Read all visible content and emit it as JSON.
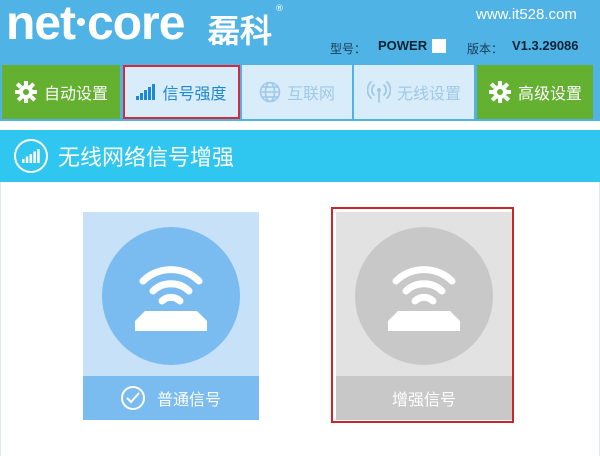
{
  "header": {
    "logo_text_left": "net",
    "logo_text_right": "core",
    "logo_cn": "磊科",
    "registered": "®",
    "watermark": "www.it528.com",
    "model_label": "型号：",
    "model_value": "POWER",
    "version_label": "版本：",
    "version_value": "V1.3.29086"
  },
  "nav": {
    "tabs": [
      {
        "label": "自动设置",
        "icon": "gear-icon"
      },
      {
        "label": "信号强度",
        "icon": "signal-bars-icon"
      },
      {
        "label": "互联网",
        "icon": "globe-icon"
      },
      {
        "label": "无线设置",
        "icon": "wireless-antenna-icon"
      },
      {
        "label": "高级设置",
        "icon": "gear-icon"
      }
    ],
    "active_tab": "信号强度"
  },
  "section": {
    "title": "无线网络信号增强",
    "icon": "signal-bars-icon"
  },
  "options": [
    {
      "label": "普通信号",
      "selected": true,
      "icon": "wifi-router-icon"
    },
    {
      "label": "增强信号",
      "selected": false,
      "icon": "wifi-router-icon"
    }
  ],
  "colors": {
    "header_bg": "#4fb3e6",
    "accent_green": "#64b031",
    "section_bg": "#2fc6ef",
    "highlight_red": "#d62a3a"
  }
}
